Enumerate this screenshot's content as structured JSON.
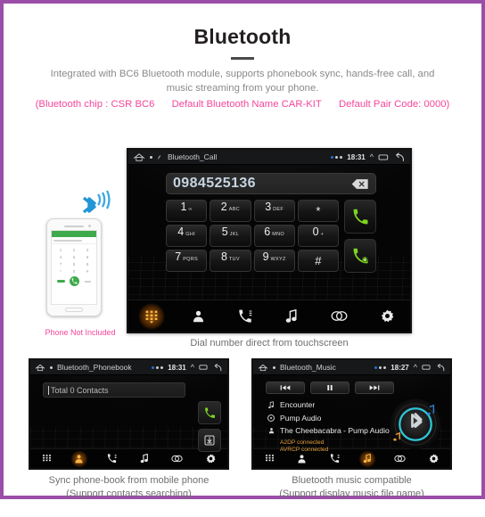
{
  "header": {
    "title": "Bluetooth",
    "subtitle": "Integrated with BC6 Bluetooth module, supports phonebook sync, hands-free call, and music streaming from your phone.",
    "spec_chip": "(Bluetooth chip : CSR BC6",
    "spec_name": "Default Bluetooth Name CAR-KIT",
    "spec_pair": "Default Pair Code: 0000)"
  },
  "theme": {
    "border": "#9b4ea8",
    "pink": "#f5469b",
    "accent_orange": "#ffb347",
    "status_orange": "#e6a23c",
    "call_green": "#7ed321",
    "bt_cyan": "#2ec6d8",
    "number_blue": "#c6d4e2"
  },
  "main_unit": {
    "statusbar": {
      "title": "Bluetooth_Call",
      "time": "18:31"
    },
    "number": "0984525136",
    "keys": [
      {
        "digit": "1",
        "sub": "∞"
      },
      {
        "digit": "2",
        "sub": "ABC"
      },
      {
        "digit": "3",
        "sub": "DEF"
      },
      {
        "digit": "*",
        "sub": ""
      },
      {
        "digit": "4",
        "sub": "GHI"
      },
      {
        "digit": "5",
        "sub": "JKL"
      },
      {
        "digit": "6",
        "sub": "MNO"
      },
      {
        "digit": "0",
        "sub": "+"
      },
      {
        "digit": "7",
        "sub": "PQRS"
      },
      {
        "digit": "8",
        "sub": "TUV"
      },
      {
        "digit": "9",
        "sub": "WXYZ"
      },
      {
        "digit": "#",
        "sub": ""
      }
    ],
    "call_button": "call-button",
    "answer_button": "answer-call-button",
    "nav": [
      {
        "icon": "keypad-icon",
        "active": true
      },
      {
        "icon": "contact-icon",
        "active": false
      },
      {
        "icon": "call-history-icon",
        "active": false
      },
      {
        "icon": "music-note-icon",
        "active": false
      },
      {
        "icon": "link-icon",
        "active": false
      },
      {
        "icon": "gear-icon",
        "active": false
      }
    ],
    "caption": "Dial number direct from touchscreen"
  },
  "phone_mockup": {
    "notice": "Phone Not Included",
    "bt_icon": "bluetooth-signal-icon",
    "keys": [
      "1",
      "2",
      "3",
      "4",
      "5",
      "6",
      "7",
      "8",
      "9",
      "*",
      "0",
      "#"
    ]
  },
  "phonebook_panel": {
    "statusbar": {
      "title": "Bluetooth_Phonebook",
      "time": "18:31"
    },
    "contacts_label": "Total 0 Contacts",
    "call_button": "call-button",
    "download_button": "download-contacts-button",
    "nav": [
      {
        "icon": "keypad-icon",
        "active": false
      },
      {
        "icon": "contact-icon",
        "active": true
      },
      {
        "icon": "call-history-icon",
        "active": false
      },
      {
        "icon": "music-note-icon",
        "active": false
      },
      {
        "icon": "link-icon",
        "active": false
      },
      {
        "icon": "gear-icon",
        "active": false
      }
    ],
    "caption_line1": "Sync phone-book from mobile phone",
    "caption_line2": "(Support contacts searching)"
  },
  "music_panel": {
    "statusbar": {
      "title": "Bluetooth_Music",
      "time": "18:27"
    },
    "controls": [
      {
        "icon": "previous-track-icon",
        "glyph": "⏮"
      },
      {
        "icon": "pause-icon",
        "glyph": "⏸"
      },
      {
        "icon": "next-track-icon",
        "glyph": "⏭"
      }
    ],
    "track_title": "Encounter",
    "album": "Pump Audio",
    "artist": "The Cheebacabra - Pump Audio",
    "status_a2dp": "A2DP connected",
    "status_avrcp": "AVRCP connected",
    "disc_icon": "bluetooth-disc-icon",
    "nav": [
      {
        "icon": "keypad-icon",
        "active": false
      },
      {
        "icon": "contact-icon",
        "active": false
      },
      {
        "icon": "call-history-icon",
        "active": false
      },
      {
        "icon": "music-note-icon",
        "active": true
      },
      {
        "icon": "link-icon",
        "active": false
      },
      {
        "icon": "gear-icon",
        "active": false
      }
    ],
    "caption_line1": "Bluetooth music compatible",
    "caption_line2": "(Support display music file name)"
  }
}
